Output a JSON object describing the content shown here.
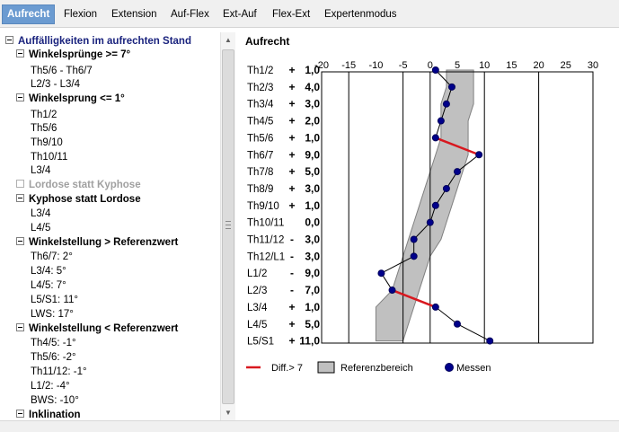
{
  "tabs": [
    {
      "label": "Aufrecht",
      "active": true
    },
    {
      "label": "Flexion",
      "active": false
    },
    {
      "label": "Extension",
      "active": false
    },
    {
      "label": "Auf-Flex",
      "active": false
    },
    {
      "label": "Ext-Auf",
      "active": false
    },
    {
      "label": "Flex-Ext",
      "active": false
    },
    {
      "label": "Expertenmodus",
      "active": false
    }
  ],
  "tree": {
    "root": "Auffälligkeiten im aufrechten Stand",
    "groups": [
      {
        "label": "Winkelsprünge >= 7°",
        "items": [
          "Th5/6 - Th6/7",
          "L2/3 - L3/4"
        ]
      },
      {
        "label": "Winkelsprung <= 1°",
        "items": [
          "Th1/2",
          "Th5/6",
          "Th9/10",
          "Th10/11",
          "L3/4"
        ]
      },
      {
        "label": "Lordose statt Kyphose",
        "items": [],
        "disabled": true
      },
      {
        "label": "Kyphose statt Lordose",
        "items": [
          "L3/4",
          "L4/5"
        ]
      },
      {
        "label": "Winkelstellung > Referenzwert",
        "items": [
          "Th6/7: 2°",
          "L3/4: 5°",
          "L4/5: 7°",
          "L5/S1: 11°",
          "LWS: 17°"
        ]
      },
      {
        "label": "Winkelstellung < Referenzwert",
        "items": [
          "Th4/5: -1°",
          "Th5/6: -2°",
          "Th11/12: -1°",
          "L1/2: -4°",
          "BWS: -10°"
        ]
      },
      {
        "label": "Inklination",
        "items": []
      }
    ]
  },
  "scrollbar": {
    "up_icon": "arrow-up-icon",
    "down_icon": "arrow-down-icon"
  },
  "colors": {
    "tab_active": "#6b9bd1",
    "root_text": "#1a237e",
    "reference_fill": "#c0c0c0",
    "marker": "#00008b",
    "diff_line": "#d8181f"
  },
  "chart_data": {
    "type": "line",
    "title": "Aufrecht",
    "xlim": [
      -20,
      30
    ],
    "x_ticks": [
      -20,
      -15,
      -10,
      -5,
      0,
      5,
      10,
      15,
      20,
      25,
      30
    ],
    "grid_lines": [
      -15,
      -5,
      0,
      10,
      20
    ],
    "segments": [
      "Th1/2",
      "Th2/3",
      "Th3/4",
      "Th4/5",
      "Th5/6",
      "Th6/7",
      "Th7/8",
      "Th8/9",
      "Th9/10",
      "Th10/11",
      "Th11/12",
      "Th12/L1",
      "L1/2",
      "L2/3",
      "L3/4",
      "L4/5",
      "L5/S1"
    ],
    "signs": [
      "+",
      "+",
      "+",
      "+",
      "+",
      "+",
      "+",
      "+",
      "+",
      "",
      "-",
      "-",
      "-",
      "-",
      "+",
      "+",
      "+"
    ],
    "value_labels": [
      "1,0",
      "4,0",
      "3,0",
      "2,0",
      "1,0",
      "9,0",
      "5,0",
      "3,0",
      "1,0",
      "0,0",
      "3,0",
      "3,0",
      "9,0",
      "7,0",
      "1,0",
      "5,0",
      "11,0"
    ],
    "values": [
      1,
      4,
      3,
      2,
      1,
      9,
      5,
      3,
      1,
      0,
      -3,
      -3,
      -9,
      -7,
      1,
      5,
      11
    ],
    "reference_band": {
      "low": [
        3,
        3,
        2,
        2,
        2,
        1,
        0,
        -1,
        -2,
        -3,
        -4,
        -5,
        -6,
        -7,
        -10,
        -10,
        -10
      ],
      "high": [
        8,
        8,
        8,
        7,
        7,
        7,
        6,
        5,
        4,
        3,
        2,
        0,
        -1,
        -2,
        -3,
        -4,
        -5
      ]
    },
    "diff_threshold_pairs": [
      [
        4,
        5
      ],
      [
        13,
        14
      ]
    ],
    "legend": [
      {
        "label": "Diff.> 7",
        "kind": "line"
      },
      {
        "label": "Referenzbereich",
        "kind": "box"
      },
      {
        "label": "Messen",
        "kind": "dot"
      }
    ]
  }
}
